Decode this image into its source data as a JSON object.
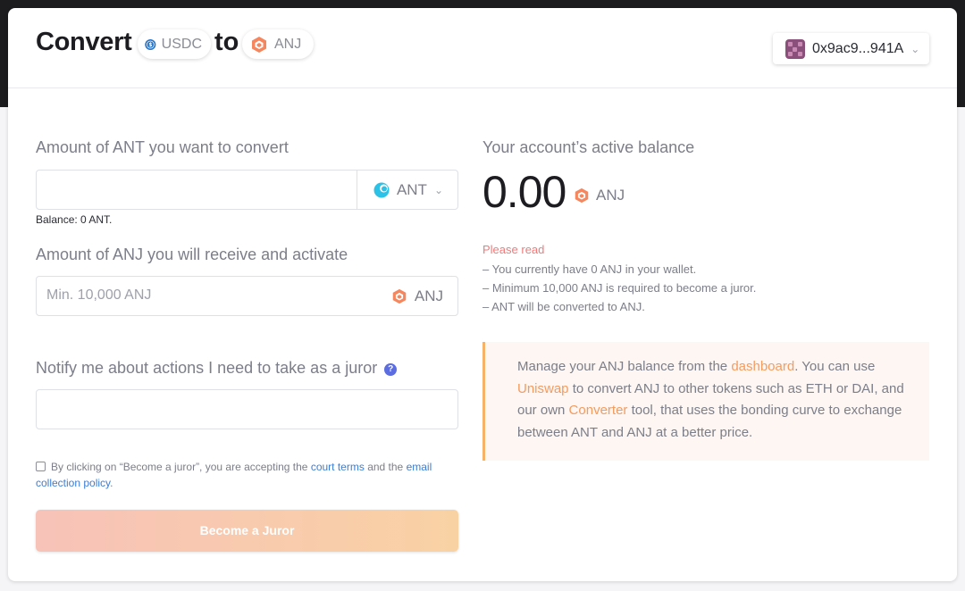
{
  "header": {
    "title_prefix": "Convert",
    "title_middle": "to",
    "from_token": "USDC",
    "to_token": "ANJ",
    "wallet_address": "0x9ac9...941A"
  },
  "form": {
    "amount_label": "Amount of ANT you want to convert",
    "amount_value": "",
    "amount_token": "ANT",
    "balance_note": "Balance: 0 ANT.",
    "receive_label": "Amount of ANJ you will receive and activate",
    "receive_placeholder": "Min. 10,000 ANJ",
    "receive_token": "ANJ",
    "notify_label": "Notify me about actions I need to take as a juror",
    "notify_value": "",
    "terms_prefix": "By clicking on “Become a juror”, you are accepting the",
    "terms_link1": "court terms",
    "terms_middle": "and the",
    "terms_link2": "email collection policy",
    "terms_suffix": ".",
    "submit_label": "Become a Juror"
  },
  "sidebar": {
    "balance_label": "Your account’s active balance",
    "balance_value": "0.00",
    "balance_token": "ANJ",
    "please_read": "Please read",
    "bullets": [
      "– You currently have 0 ANJ in your wallet.",
      "– Minimum 10,000 ANJ is required to become a juror.",
      "– ANT will be converted to ANJ."
    ],
    "info": {
      "t1": "Manage your ANJ balance from the",
      "link1": "dashboard",
      "t2": ". You can use",
      "link2": "Uniswap",
      "t3": "to convert ANJ to other tokens such as ETH or DAI, and our own",
      "link3": "Converter",
      "t4": "tool, that uses the bonding curve to exchange between ANT and ANJ at a better price."
    }
  },
  "icons": {
    "usdc": "usdc-token-icon",
    "anj": "anj-token-icon",
    "ant": "ant-token-icon",
    "help": "help-icon",
    "chevron": "chevron-down-icon"
  },
  "colors": {
    "accent_orange": "#f49b5e",
    "link_blue": "#3b7ed6",
    "warning_red": "#ef7a7a",
    "usdc_blue": "#2775ca",
    "anj_orange": "#f5865e"
  }
}
